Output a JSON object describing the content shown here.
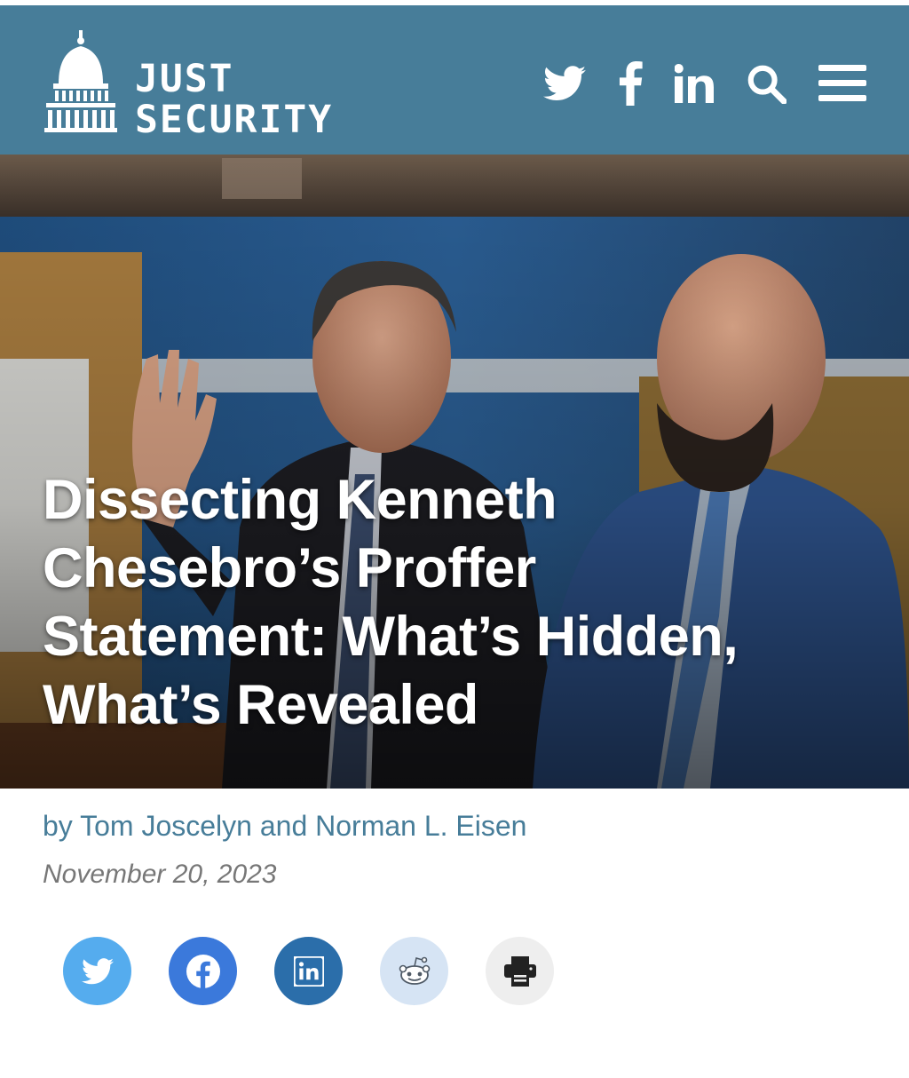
{
  "site": {
    "logo_line1": "JUST",
    "logo_line2": "SECURITY"
  },
  "header": {
    "nav_icons": [
      "twitter-icon",
      "facebook-icon",
      "linkedin-icon",
      "search-icon",
      "menu-icon"
    ]
  },
  "article": {
    "headline_line1": "Dissecting Kenneth",
    "headline_line2": "Chesebro’s Proffer",
    "headline_line3": "Statement: What’s Hidden,",
    "headline_line4": "What’s Revealed",
    "byline_prefix": "by",
    "byline_author1": "Tom Joscelyn",
    "byline_conjunction": "and",
    "byline_author2": "Norman L. Eisen",
    "date": "November 20, 2023"
  },
  "share": {
    "buttons": [
      "twitter",
      "facebook",
      "linkedin",
      "reddit",
      "print"
    ]
  },
  "colors": {
    "header_bg": "#477d99",
    "byline": "#477d99",
    "date": "#777777",
    "twitter": "#55acee",
    "facebook": "#3b79db",
    "linkedin": "#2b6eaa",
    "reddit_bg": "#d6e4f4",
    "print_bg": "#eeeeee"
  }
}
